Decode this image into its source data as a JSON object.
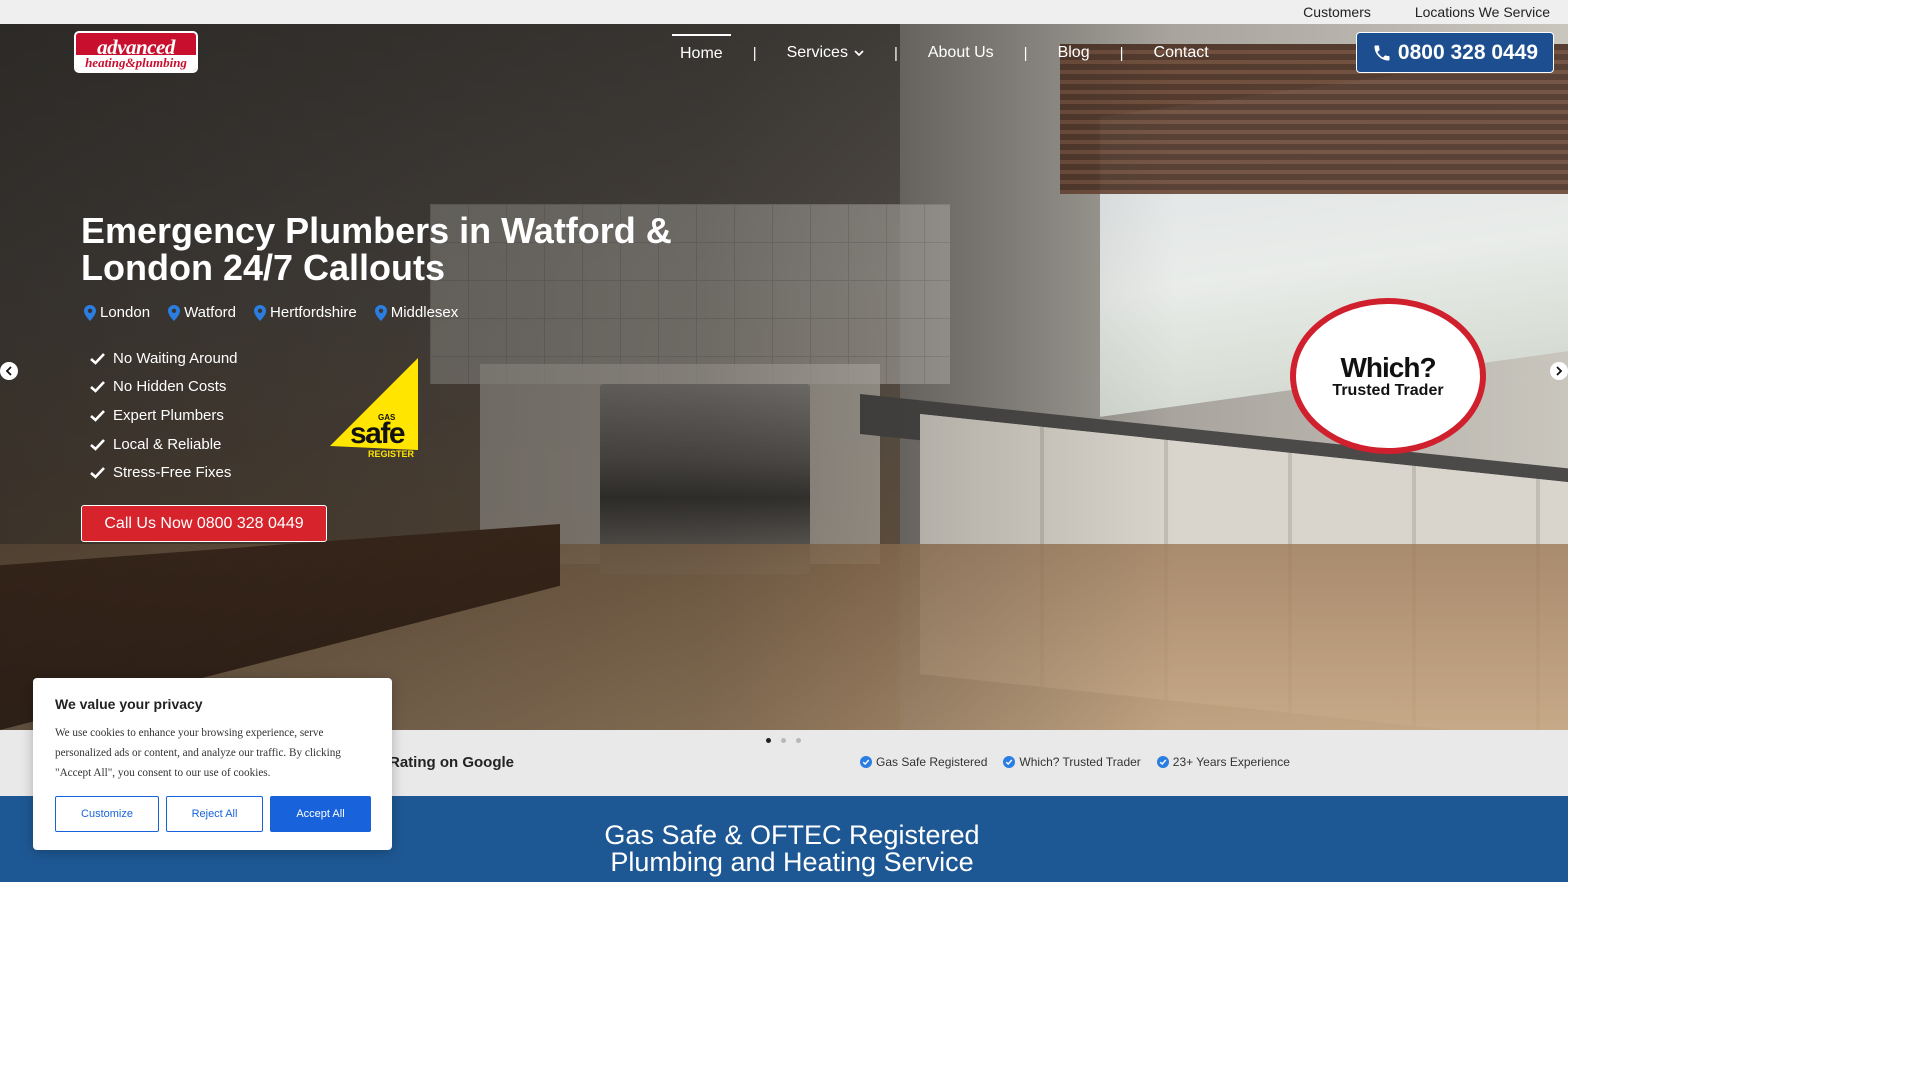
{
  "topbar": {
    "links": [
      "Customers",
      "Locations We Service"
    ]
  },
  "logo": {
    "line1": "advanced",
    "line2": "heating&plumbing"
  },
  "nav": {
    "items": [
      "Home",
      "Services",
      "About Us",
      "Blog",
      "Contact"
    ],
    "separator": "|"
  },
  "header_phone": "0800 328 0449",
  "hero": {
    "title": "Emergency Plumbers in Watford & London 24/7 Callouts",
    "locations": [
      "London",
      "Watford",
      "Hertfordshire",
      "Middlesex"
    ],
    "checks": [
      "No Waiting Around",
      "No Hidden Costs",
      "Expert Plumbers",
      "Local & Reliable",
      "Stress-Free Fixes"
    ],
    "cta": "Call Us Now 0800 328 0449",
    "gas_safe": {
      "top": "GAS",
      "main": "safe",
      "bottom": "REGISTER"
    },
    "which": {
      "line1": "Which?",
      "line2": "Trusted Trader"
    }
  },
  "strip": {
    "rating": "Rating on Google",
    "badges": [
      "Gas Safe Registered",
      "Which? Trusted Trader",
      "23+ Years Experience"
    ]
  },
  "band": {
    "line1": "Gas Safe & OFTEC Registered",
    "line2": "Plumbing and Heating Service"
  },
  "cookie": {
    "title": "We value your privacy",
    "text": "We use cookies to enhance your browsing experience, serve personalized ads or content, and analyze our traffic. By clicking \"Accept All\", you consent to our use of cookies.",
    "customize": "Customize",
    "reject": "Reject All",
    "accept": "Accept All"
  },
  "colors": {
    "brand_red": "#d7232b",
    "brand_blue": "#1e5894",
    "cookie_blue": "#1863dc"
  }
}
